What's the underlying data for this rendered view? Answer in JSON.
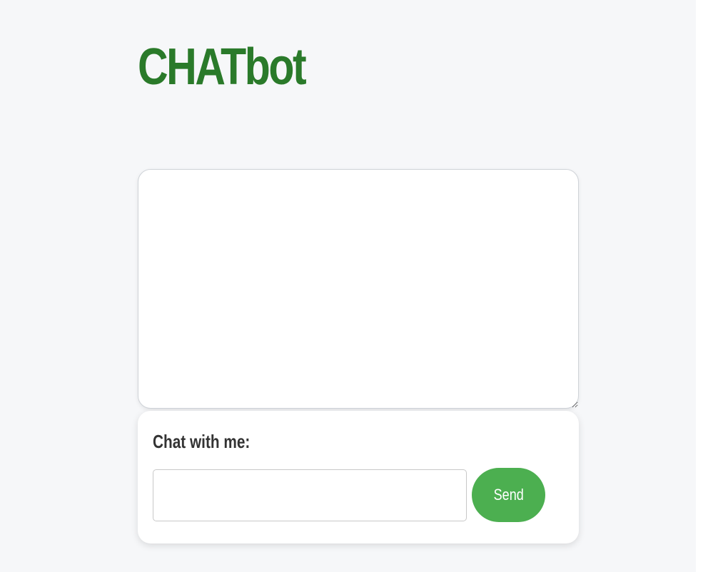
{
  "app": {
    "title": "CHATbot"
  },
  "chat_log": {
    "content": ""
  },
  "composer": {
    "label": "Chat with me:",
    "input_value": "",
    "send_label": "Send"
  },
  "colors": {
    "title": "#2a7a2a",
    "send_button": "#4caf50",
    "background": "#f6f7f9"
  }
}
